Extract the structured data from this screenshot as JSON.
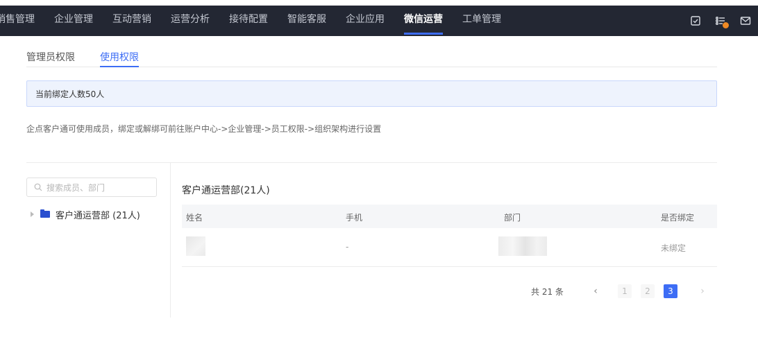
{
  "nav": {
    "items": [
      "销售管理",
      "企业管理",
      "互动营销",
      "运营分析",
      "接待配置",
      "智能客服",
      "企业应用",
      "微信运营",
      "工单管理"
    ],
    "active_index": 7
  },
  "nav_icons": [
    "task-check-icon",
    "list-notification-icon",
    "mail-icon"
  ],
  "colors": {
    "nav_bg": "#232733",
    "accent": "#3d6df5",
    "info_bg": "#eef3fd",
    "notify_dot": "#f08a24"
  },
  "subtabs": {
    "admin": "管理员权限",
    "usage": "使用权限",
    "active": "usage"
  },
  "info": {
    "bound_count_text": "当前绑定人数50人"
  },
  "description": "企点客户通可使用成员，绑定或解绑可前往账户中心->企业管理->员工权限->组织架构进行设置",
  "search": {
    "placeholder": "搜索成员、部门",
    "value": ""
  },
  "tree": {
    "node_label": "客户通运营部 (21人)"
  },
  "dept": {
    "title": "客户通运营部(21人)"
  },
  "table": {
    "headers": {
      "name": "姓名",
      "phone": "手机",
      "dept": "部门",
      "bound": "是否绑定"
    },
    "rows": [
      {
        "phone": "-",
        "bound": "未绑定"
      }
    ]
  },
  "pagination": {
    "total_text": "共 21 条",
    "prev": "‹",
    "next": "›",
    "pages": [
      "1",
      "2",
      "3"
    ],
    "current": "3"
  }
}
